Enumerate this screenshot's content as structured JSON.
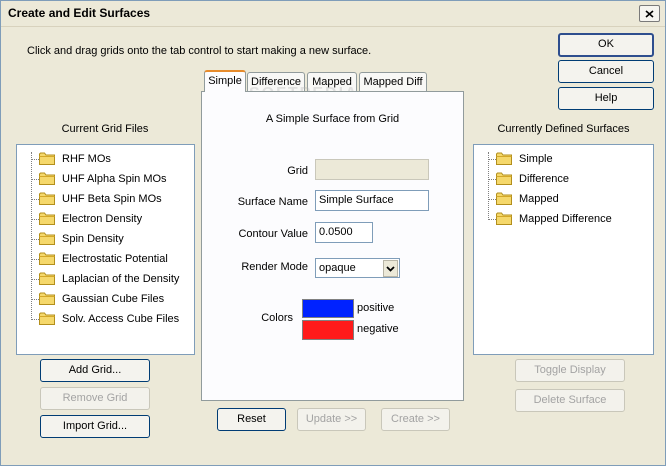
{
  "window": {
    "title": "Create and Edit Surfaces"
  },
  "instruction": "Click and drag grids onto the tab control to start making a new surface.",
  "dialog_buttons": {
    "ok": "OK",
    "cancel": "Cancel",
    "help": "Help"
  },
  "left_panel": {
    "heading": "Current Grid Files",
    "items": [
      "RHF MOs",
      "UHF Alpha Spin MOs",
      "UHF Beta Spin MOs",
      "Electron Density",
      "Spin Density",
      "Electrostatic Potential",
      "Laplacian of the Density",
      "Gaussian Cube Files",
      "Solv. Access Cube Files"
    ],
    "buttons": {
      "add": "Add Grid...",
      "remove": "Remove Grid",
      "import": "Import Grid..."
    }
  },
  "tabs": [
    "Simple",
    "Difference",
    "Mapped",
    "Mapped Diff"
  ],
  "simple_tab": {
    "heading": "A Simple Surface from Grid",
    "grid_label": "Grid",
    "grid_value": "",
    "surface_name_label": "Surface Name",
    "surface_name_value": "Simple Surface",
    "contour_label": "Contour Value",
    "contour_value": "0.0500",
    "render_label": "Render Mode",
    "render_value": "opaque",
    "colors_label": "Colors",
    "positive_label": "positive",
    "negative_label": "negative",
    "positive_color": "#0022ff",
    "negative_color": "#ff1a1a"
  },
  "bottom_buttons": {
    "reset": "Reset",
    "update": "Update >>",
    "create": "Create >>"
  },
  "right_panel": {
    "heading": "Currently Defined Surfaces",
    "items": [
      "Simple",
      "Difference",
      "Mapped",
      "Mapped Difference"
    ],
    "buttons": {
      "toggle": "Toggle Display",
      "delete": "Delete Surface"
    }
  },
  "watermark": "SOFTPEDIA",
  "icons": {
    "folder": "folder-icon",
    "close": "close-icon",
    "dropdown": "chevron-down-icon"
  }
}
